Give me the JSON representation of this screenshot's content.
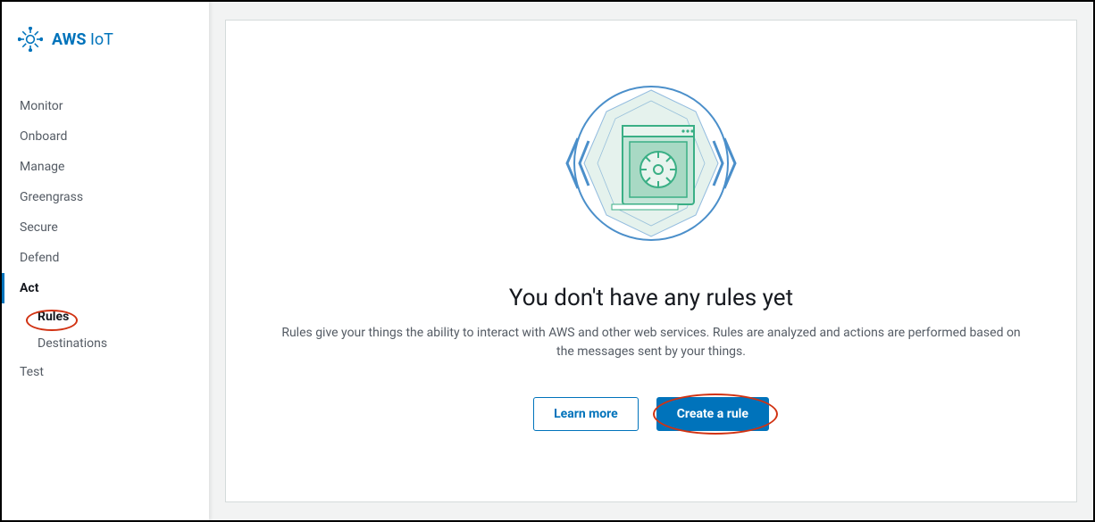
{
  "sidebar": {
    "title_bold": "AWS",
    "title_light": "IoT",
    "items": [
      {
        "label": "Monitor"
      },
      {
        "label": "Onboard"
      },
      {
        "label": "Manage"
      },
      {
        "label": "Greengrass"
      },
      {
        "label": "Secure"
      },
      {
        "label": "Defend"
      },
      {
        "label": "Act",
        "active": true
      },
      {
        "label": "Test"
      }
    ],
    "act_subitems": [
      {
        "label": "Rules",
        "selected": true
      },
      {
        "label": "Destinations"
      }
    ]
  },
  "main": {
    "empty_title": "You don't have any rules yet",
    "empty_description": "Rules give your things the ability to interact with AWS and other web services. Rules are analyzed and actions are performed based on the messages sent by your things.",
    "learn_more_label": "Learn more",
    "create_rule_label": "Create a rule"
  }
}
